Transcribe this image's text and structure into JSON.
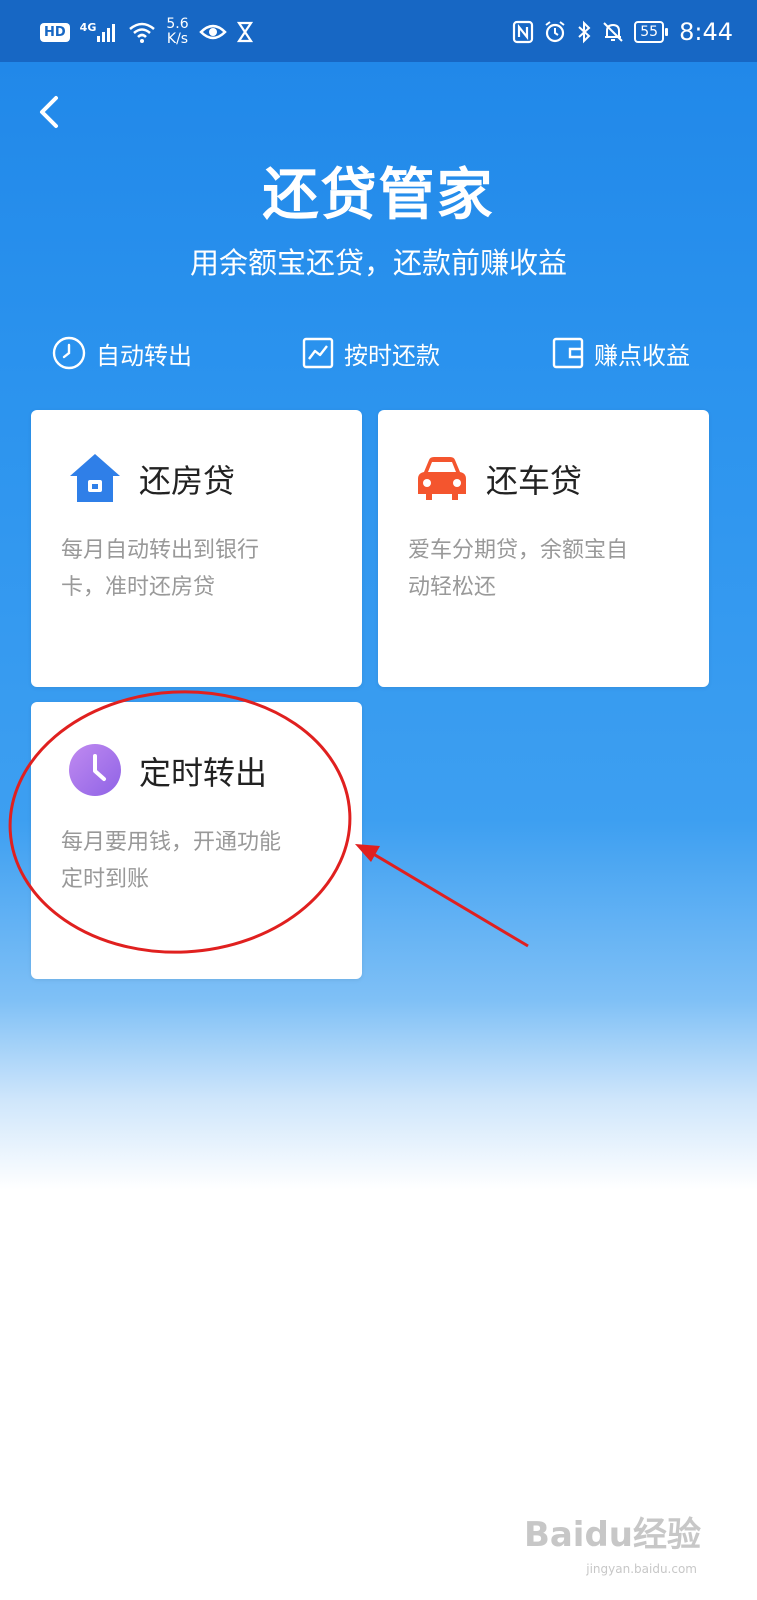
{
  "status_bar": {
    "hd": "HD",
    "network": "4G",
    "speed_value": "5.6",
    "speed_unit": "K/s",
    "battery": "55",
    "time": "8:44"
  },
  "header": {
    "title": "还贷管家",
    "subtitle": "用余额宝还贷，还款前赚收益"
  },
  "features": [
    {
      "label": "自动转出",
      "icon": "clock-outline-icon"
    },
    {
      "label": "按时还款",
      "icon": "chart-outline-icon"
    },
    {
      "label": "赚点收益",
      "icon": "wallet-outline-icon"
    }
  ],
  "cards": [
    {
      "title": "还房贷",
      "desc_line1": "每月自动转出到银行",
      "desc_line2": "卡，准时还房贷",
      "icon": "house-icon",
      "icon_color": "#2f7fe8"
    },
    {
      "title": "还车贷",
      "desc_line1": "爱车分期贷，余额宝自",
      "desc_line2": "动轻松还",
      "icon": "car-icon",
      "icon_color": "#f4552e"
    },
    {
      "title": "定时转出",
      "desc_line1": "每月要用钱，开通功能",
      "desc_line2": "定时到账",
      "icon": "clock-icon",
      "icon_color": "#a978ea"
    }
  ],
  "watermark": {
    "logo": "Baidu经验",
    "url": "jingyan.baidu.com"
  },
  "colors": {
    "status_bar": "#1767c4",
    "background_top": "#1f86e8",
    "annotation_red": "#e0201f"
  }
}
